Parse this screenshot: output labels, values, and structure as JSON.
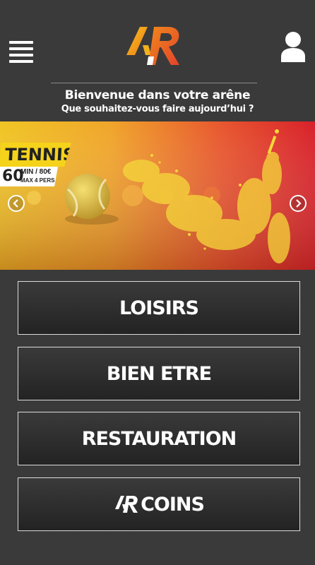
{
  "header": {
    "menu_icon": "hamburger-menu-icon",
    "logo_icon": "ar-logo",
    "user_icon": "user-profile-icon"
  },
  "welcome": {
    "line1": "Bienvenue dans votre arêne",
    "line2": "Que souhaitez-vous faire aujourd’hui ?"
  },
  "banner": {
    "activity": "TENNIS",
    "duration": "60",
    "duration_unit": "MIN / 80€",
    "capacity": "MAX 4 PERS",
    "prev_icon": "chevron-left-icon",
    "next_icon": "chevron-right-icon"
  },
  "menu": {
    "loisirs": "LOISIRS",
    "bien_etre": "BIEN ETRE",
    "restauration": "RESTAURATION",
    "coins": "COINS"
  },
  "colors": {
    "background": "#3a3a3a",
    "accent_orange": "#f08a1c",
    "accent_yellow": "#f5d31a",
    "button_border": "#dcdcdc"
  }
}
